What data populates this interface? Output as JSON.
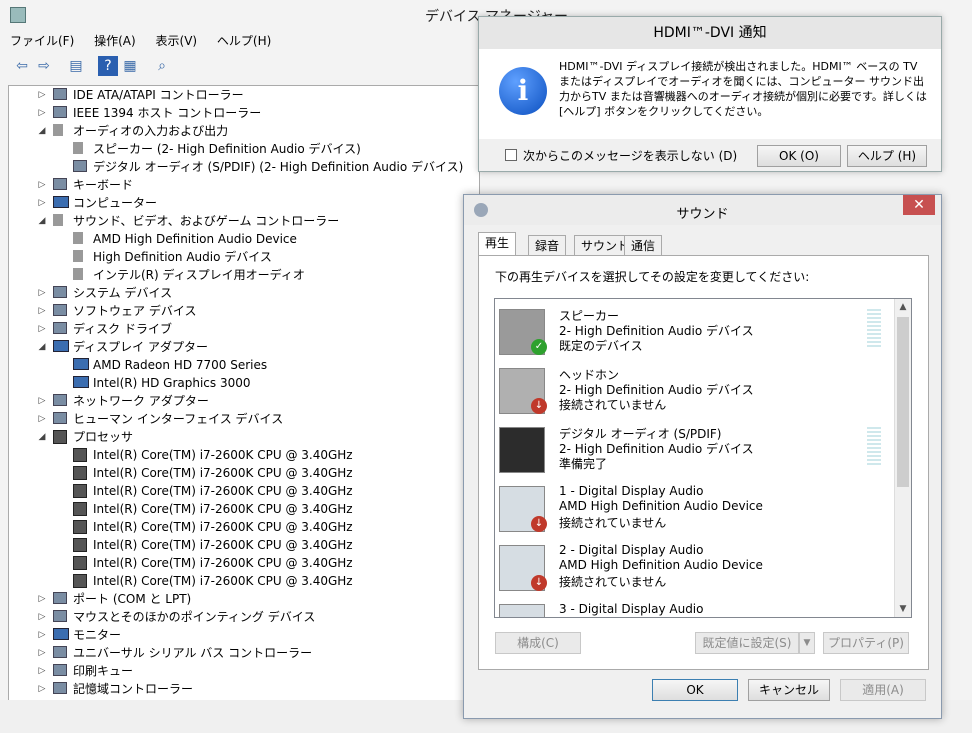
{
  "device_manager": {
    "title": "デバイス マネージャー",
    "menu": [
      "ファイル(F)",
      "操作(A)",
      "表示(V)",
      "ヘルプ(H)"
    ],
    "tree": [
      {
        "label": "IDE ATA/ATAPI コントローラー",
        "level": 0,
        "expander": "▷",
        "icon": "ide-controller-icon"
      },
      {
        "label": "IEEE 1394 ホスト コントローラー",
        "level": 0,
        "expander": "▷",
        "icon": "ieee1394-icon"
      },
      {
        "label": "オーディオの入力および出力",
        "level": 0,
        "expander": "◢",
        "icon": "audio-io-icon"
      },
      {
        "label": "スピーカー (2- High Definition Audio デバイス)",
        "level": 1,
        "expander": "",
        "icon": "speaker-icon"
      },
      {
        "label": "デジタル オーディオ (S/PDIF) (2- High Definition Audio デバイス)",
        "level": 1,
        "expander": "",
        "icon": "spdif-icon"
      },
      {
        "label": "キーボード",
        "level": 0,
        "expander": "▷",
        "icon": "keyboard-icon"
      },
      {
        "label": "コンピューター",
        "level": 0,
        "expander": "▷",
        "icon": "computer-icon"
      },
      {
        "label": "サウンド、ビデオ、およびゲーム コントローラー",
        "level": 0,
        "expander": "◢",
        "icon": "sound-controller-icon"
      },
      {
        "label": "AMD High Definition Audio Device",
        "level": 1,
        "expander": "",
        "icon": "speaker-icon"
      },
      {
        "label": "High Definition Audio デバイス",
        "level": 1,
        "expander": "",
        "icon": "speaker-icon"
      },
      {
        "label": "インテル(R) ディスプレイ用オーディオ",
        "level": 1,
        "expander": "",
        "icon": "speaker-icon"
      },
      {
        "label": "システム デバイス",
        "level": 0,
        "expander": "▷",
        "icon": "system-device-icon"
      },
      {
        "label": "ソフトウェア デバイス",
        "level": 0,
        "expander": "▷",
        "icon": "software-device-icon"
      },
      {
        "label": "ディスク ドライブ",
        "level": 0,
        "expander": "▷",
        "icon": "disk-drive-icon"
      },
      {
        "label": "ディスプレイ アダプター",
        "level": 0,
        "expander": "◢",
        "icon": "display-adapter-icon"
      },
      {
        "label": "AMD Radeon HD 7700 Series",
        "level": 1,
        "expander": "",
        "icon": "display-adapter-icon"
      },
      {
        "label": "Intel(R) HD Graphics 3000",
        "level": 1,
        "expander": "",
        "icon": "display-adapter-icon"
      },
      {
        "label": "ネットワーク アダプター",
        "level": 0,
        "expander": "▷",
        "icon": "network-adapter-icon"
      },
      {
        "label": "ヒューマン インターフェイス デバイス",
        "level": 0,
        "expander": "▷",
        "icon": "hid-icon"
      },
      {
        "label": "プロセッサ",
        "level": 0,
        "expander": "◢",
        "icon": "processor-icon"
      },
      {
        "label": "Intel(R) Core(TM) i7-2600K CPU @ 3.40GHz",
        "level": 1,
        "expander": "",
        "icon": "processor-icon"
      },
      {
        "label": "Intel(R) Core(TM) i7-2600K CPU @ 3.40GHz",
        "level": 1,
        "expander": "",
        "icon": "processor-icon"
      },
      {
        "label": "Intel(R) Core(TM) i7-2600K CPU @ 3.40GHz",
        "level": 1,
        "expander": "",
        "icon": "processor-icon"
      },
      {
        "label": "Intel(R) Core(TM) i7-2600K CPU @ 3.40GHz",
        "level": 1,
        "expander": "",
        "icon": "processor-icon"
      },
      {
        "label": "Intel(R) Core(TM) i7-2600K CPU @ 3.40GHz",
        "level": 1,
        "expander": "",
        "icon": "processor-icon"
      },
      {
        "label": "Intel(R) Core(TM) i7-2600K CPU @ 3.40GHz",
        "level": 1,
        "expander": "",
        "icon": "processor-icon"
      },
      {
        "label": "Intel(R) Core(TM) i7-2600K CPU @ 3.40GHz",
        "level": 1,
        "expander": "",
        "icon": "processor-icon"
      },
      {
        "label": "Intel(R) Core(TM) i7-2600K CPU @ 3.40GHz",
        "level": 1,
        "expander": "",
        "icon": "processor-icon"
      },
      {
        "label": "ポート (COM と LPT)",
        "level": 0,
        "expander": "▷",
        "icon": "port-icon"
      },
      {
        "label": "マウスとそのほかのポインティング デバイス",
        "level": 0,
        "expander": "▷",
        "icon": "mouse-icon"
      },
      {
        "label": "モニター",
        "level": 0,
        "expander": "▷",
        "icon": "monitor-icon"
      },
      {
        "label": "ユニバーサル シリアル バス コントローラー",
        "level": 0,
        "expander": "▷",
        "icon": "usb-icon"
      },
      {
        "label": "印刷キュー",
        "level": 0,
        "expander": "▷",
        "icon": "printer-icon"
      },
      {
        "label": "記憶域コントローラー",
        "level": 0,
        "expander": "▷",
        "icon": "storage-controller-icon"
      }
    ]
  },
  "hdmi_notice": {
    "title": "HDMI™-DVI 通知",
    "message": "HDMI™-DVI ディスプレイ接続が検出されました。HDMI™ ベースの TV またはディスプレイでオーディオを聞くには、コンピューター サウンド出力からTV または音響機器へのオーディオ接続が個別に必要です。詳しくは [ヘルプ] ボタンをクリックしてください。",
    "checkbox_label": "次からこのメッセージを表示しない (D)",
    "ok_label": "OK  (O)",
    "help_label": "ヘルプ (H)"
  },
  "sound_dialog": {
    "title": "サウンド",
    "tabs": [
      "再生",
      "録音",
      "サウンド",
      "通信"
    ],
    "prompt": "下の再生デバイスを選択してその設定を変更してください:",
    "devices": [
      {
        "name": "スピーカー",
        "driver": "2- High Definition Audio デバイス",
        "status": "既定のデバイス",
        "icon": "speaker-device-icon",
        "badge": "default-check-icon"
      },
      {
        "name": "ヘッドホン",
        "driver": "2- High Definition Audio デバイス",
        "status": "接続されていません",
        "icon": "headphones-icon",
        "badge": "unplugged-icon"
      },
      {
        "name": "デジタル オーディオ (S/PDIF)",
        "driver": "2- High Definition Audio デバイス",
        "status": "準備完了",
        "icon": "digital-audio-icon",
        "badge": ""
      },
      {
        "name": "1 - Digital Display Audio",
        "driver": "AMD High Definition Audio Device",
        "status": "接続されていません",
        "icon": "display-audio-icon",
        "badge": "unplugged-icon"
      },
      {
        "name": "2 - Digital Display Audio",
        "driver": "AMD High Definition Audio Device",
        "status": "接続されていません",
        "icon": "display-audio-icon",
        "badge": "unplugged-icon"
      },
      {
        "name": "3 - Digital Display Audio",
        "driver": "",
        "status": "",
        "icon": "display-audio-icon",
        "badge": ""
      }
    ],
    "configure_label": "構成(C)",
    "set_default_label": "既定値に設定(S)",
    "properties_label": "プロパティ(P)",
    "ok_label": "OK",
    "cancel_label": "キャンセル",
    "apply_label": "適用(A)"
  }
}
